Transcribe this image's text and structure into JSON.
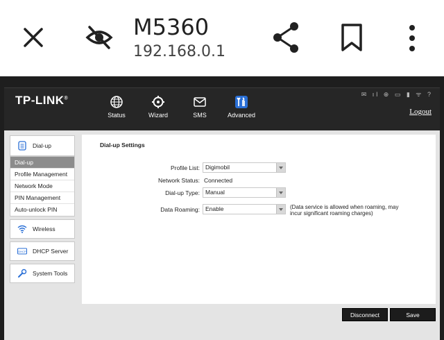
{
  "browser": {
    "title": "M5360",
    "url": "192.168.0.1"
  },
  "router": {
    "brand": "TP-LINK",
    "nav": [
      {
        "label": "Status",
        "icon": "globe-icon"
      },
      {
        "label": "Wizard",
        "icon": "wizard-icon"
      },
      {
        "label": "SMS",
        "icon": "mail-icon"
      },
      {
        "label": "Advanced",
        "icon": "tools-icon"
      }
    ],
    "status_icons": "✉ ıl ⊕ ▭ ▮ ᯤ ?",
    "logout": "Logout"
  },
  "sidebar": {
    "dialup_group": "Dial-up",
    "dialup_items": [
      "Dial-up",
      "Profile Management",
      "Network Mode",
      "PIN Management",
      "Auto-unlock PIN"
    ],
    "wireless": "Wireless",
    "dhcp": "DHCP Server",
    "system": "System Tools"
  },
  "content": {
    "title": "Dial-up Settings",
    "profile_list_label": "Profile List:",
    "profile_list_value": "Digimobil",
    "network_status_label": "Network Status:",
    "network_status_value": "Connected",
    "dialup_type_label": "Dial-up Type:",
    "dialup_type_value": "Manual",
    "data_roaming_label": "Data Roaming:",
    "data_roaming_value": "Enable",
    "roaming_note": "(Data service is allowed when roaming, may incur significant roaming charges)"
  },
  "buttons": {
    "disconnect": "Disconnect",
    "save": "Save"
  },
  "colors": {
    "accent": "#1c1c1c",
    "active_item": "#8c8c8c"
  }
}
